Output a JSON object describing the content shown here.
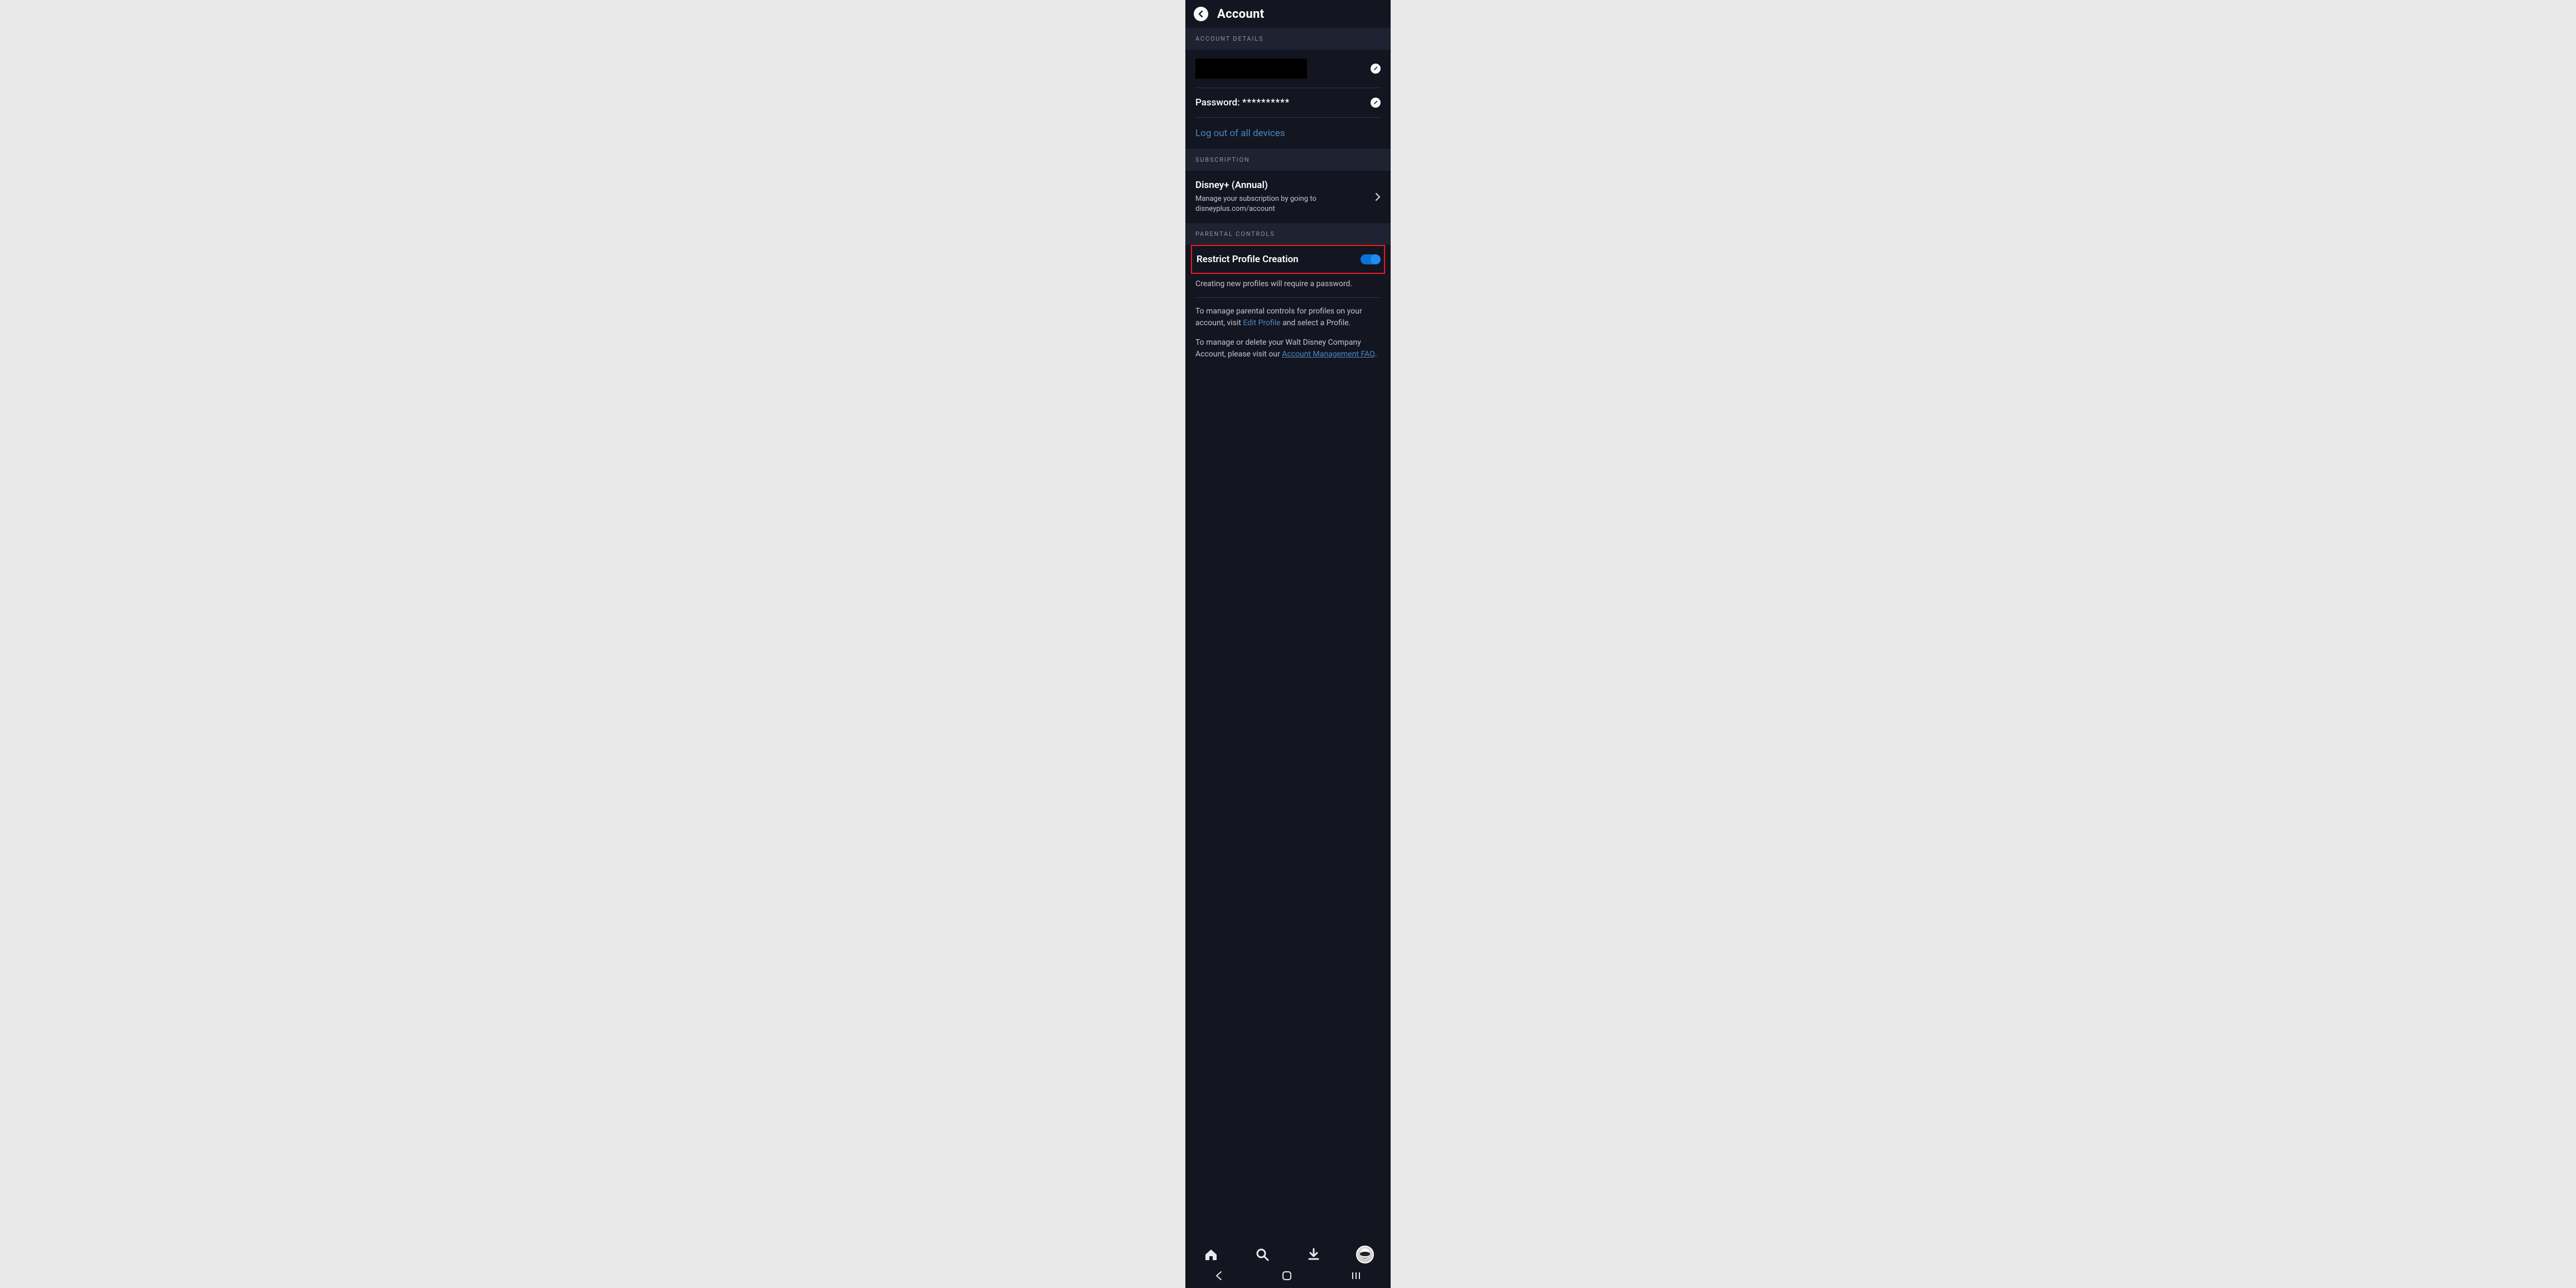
{
  "header": {
    "title": "Account"
  },
  "sections": {
    "accountDetails": {
      "header": "ACCOUNT DETAILS",
      "passwordLabel": "Password:",
      "passwordValue": "**********",
      "logoutAllLabel": "Log out of all devices"
    },
    "subscription": {
      "header": "SUBSCRIPTION",
      "planTitle": "Disney+ (Annual)",
      "planDesc": "Manage your subscription by going to disneyplus.com/account"
    },
    "parentalControls": {
      "header": "PARENTAL CONTROLS",
      "restrictLabel": "Restrict Profile Creation",
      "restrictOn": true,
      "restrictHint": "Creating new profiles will require a password.",
      "manageTextA": "To manage parental controls for profiles on your account, visit ",
      "manageLink": "Edit Profile",
      "manageTextB": " and select a Profile.",
      "deleteTextA": "To manage or delete your Walt Disney Company Account, please visit our ",
      "deleteLink": "Account Management FAQ",
      "deleteTextB": "."
    }
  }
}
